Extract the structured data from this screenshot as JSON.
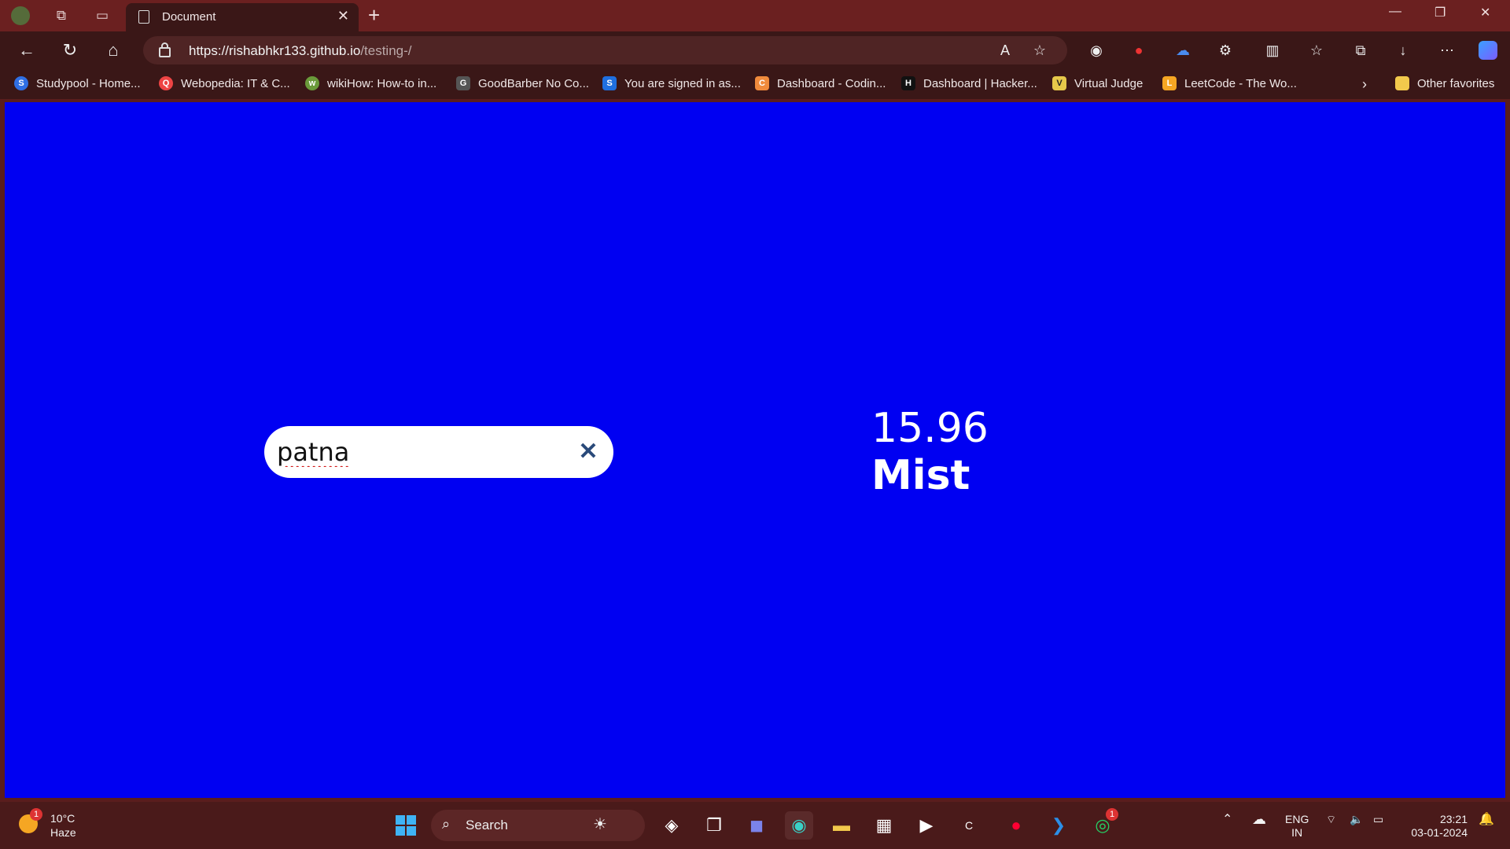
{
  "browser": {
    "tab_title": "Document",
    "url_host": "https://rishabhkr133.github.io",
    "url_path": "/testing-/",
    "favorites": [
      {
        "label": "Studypool - Home...",
        "icon": "studypool-icon",
        "color": "#2f6fe4"
      },
      {
        "label": "Webopedia: IT & C...",
        "icon": "webopedia-icon",
        "color": "#e44"
      },
      {
        "label": "wikiHow: How-to in...",
        "icon": "wikihow-icon",
        "color": "#6a9a3a"
      },
      {
        "label": "GoodBarber No Co...",
        "icon": "goodbarber-icon",
        "color": "#555"
      },
      {
        "label": "You are signed in as...",
        "icon": "s-icon",
        "color": "#1f6fe0"
      },
      {
        "label": "Dashboard - Codin...",
        "icon": "codingninjas-icon",
        "color": "#f08a3c"
      },
      {
        "label": "Dashboard | Hacker...",
        "icon": "hackerrank-icon",
        "color": "#111"
      },
      {
        "label": "Virtual Judge",
        "icon": "vjudge-icon",
        "color": "#e6c84a"
      },
      {
        "label": "LeetCode - The Wo...",
        "icon": "leetcode-icon",
        "color": "#f6a623"
      }
    ],
    "other_favorites": "Other favorites"
  },
  "app": {
    "search_value": "patna",
    "temperature": "15.96",
    "condition": "Mist",
    "background_color": "#0000f2"
  },
  "taskbar": {
    "weather_temp": "10°C",
    "weather_desc": "Haze",
    "weather_badge": "1",
    "search_label": "Search",
    "lang": "ENG",
    "region": "IN",
    "time": "23:21",
    "date": "03-01-2024",
    "whatsapp_badge": "1"
  }
}
